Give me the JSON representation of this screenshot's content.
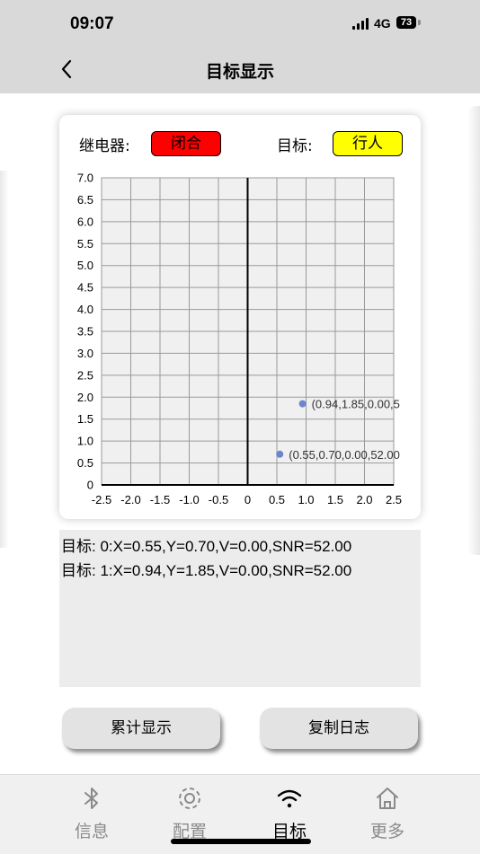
{
  "status": {
    "time": "09:07",
    "network": "4G",
    "battery": "73"
  },
  "nav": {
    "title": "目标显示"
  },
  "card": {
    "relay_label": "继电器:",
    "relay_state": "闭合",
    "relay_color": "#ff0000",
    "target_label": "目标:",
    "target_type": "行人",
    "target_color": "#ffff00"
  },
  "chart_data": {
    "type": "scatter",
    "xlim": [
      -2.5,
      2.5
    ],
    "ylim": [
      0,
      7.0
    ],
    "x_ticks": [
      "-2.5",
      "-2.0",
      "-1.5",
      "-1.0",
      "-0.5",
      "0",
      "0.5",
      "1.0",
      "1.5",
      "2.0",
      "2.5"
    ],
    "y_ticks": [
      "0",
      "0.5",
      "1.0",
      "1.5",
      "2.0",
      "2.5",
      "3.0",
      "3.5",
      "4.0",
      "4.5",
      "5.0",
      "5.5",
      "6.0",
      "6.5",
      "7.0"
    ],
    "grid": true,
    "point_color": "#6b86d0",
    "points": [
      {
        "x": 0.55,
        "y": 0.7,
        "label": "(0.55,0.70,0.00,52.00"
      },
      {
        "x": 0.94,
        "y": 1.85,
        "label": "(0.94,1.85,0.00,5"
      }
    ]
  },
  "log": {
    "lines": [
      "目标:  0:X=0.55,Y=0.70,V=0.00,SNR=52.00",
      "目标:  1:X=0.94,Y=1.85,V=0.00,SNR=52.00"
    ]
  },
  "buttons": {
    "cumulative": "累计显示",
    "copy_log": "复制日志"
  },
  "tabs": [
    {
      "label": "信息",
      "icon": "bluetooth-icon"
    },
    {
      "label": "配置",
      "icon": "gear-icon"
    },
    {
      "label": "目标",
      "icon": "wifi-icon"
    },
    {
      "label": "更多",
      "icon": "home-icon"
    }
  ]
}
